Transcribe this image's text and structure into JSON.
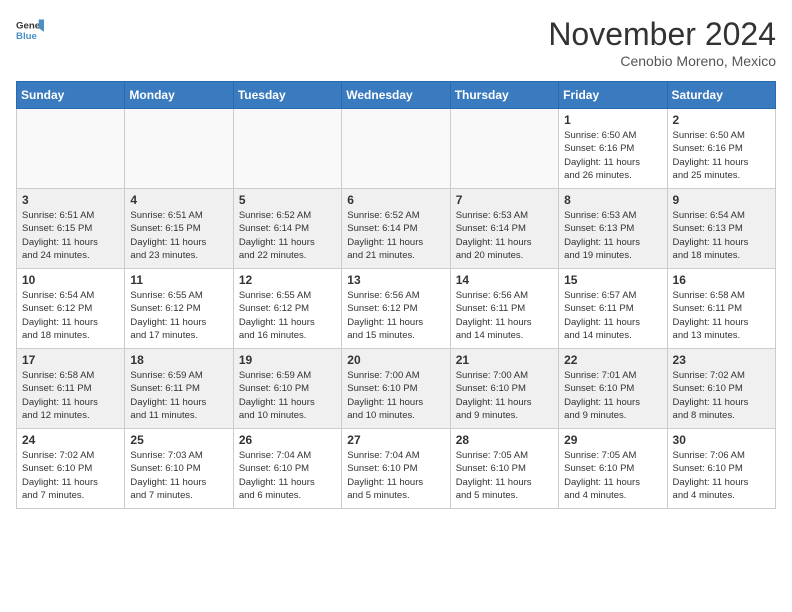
{
  "logo": {
    "text_general": "General",
    "text_blue": "Blue"
  },
  "title": "November 2024",
  "subtitle": "Cenobio Moreno, Mexico",
  "days_of_week": [
    "Sunday",
    "Monday",
    "Tuesday",
    "Wednesday",
    "Thursday",
    "Friday",
    "Saturday"
  ],
  "weeks": [
    [
      {
        "day": "",
        "info": ""
      },
      {
        "day": "",
        "info": ""
      },
      {
        "day": "",
        "info": ""
      },
      {
        "day": "",
        "info": ""
      },
      {
        "day": "",
        "info": ""
      },
      {
        "day": "1",
        "info": "Sunrise: 6:50 AM\nSunset: 6:16 PM\nDaylight: 11 hours\nand 26 minutes."
      },
      {
        "day": "2",
        "info": "Sunrise: 6:50 AM\nSunset: 6:16 PM\nDaylight: 11 hours\nand 25 minutes."
      }
    ],
    [
      {
        "day": "3",
        "info": "Sunrise: 6:51 AM\nSunset: 6:15 PM\nDaylight: 11 hours\nand 24 minutes."
      },
      {
        "day": "4",
        "info": "Sunrise: 6:51 AM\nSunset: 6:15 PM\nDaylight: 11 hours\nand 23 minutes."
      },
      {
        "day": "5",
        "info": "Sunrise: 6:52 AM\nSunset: 6:14 PM\nDaylight: 11 hours\nand 22 minutes."
      },
      {
        "day": "6",
        "info": "Sunrise: 6:52 AM\nSunset: 6:14 PM\nDaylight: 11 hours\nand 21 minutes."
      },
      {
        "day": "7",
        "info": "Sunrise: 6:53 AM\nSunset: 6:14 PM\nDaylight: 11 hours\nand 20 minutes."
      },
      {
        "day": "8",
        "info": "Sunrise: 6:53 AM\nSunset: 6:13 PM\nDaylight: 11 hours\nand 19 minutes."
      },
      {
        "day": "9",
        "info": "Sunrise: 6:54 AM\nSunset: 6:13 PM\nDaylight: 11 hours\nand 18 minutes."
      }
    ],
    [
      {
        "day": "10",
        "info": "Sunrise: 6:54 AM\nSunset: 6:12 PM\nDaylight: 11 hours\nand 18 minutes."
      },
      {
        "day": "11",
        "info": "Sunrise: 6:55 AM\nSunset: 6:12 PM\nDaylight: 11 hours\nand 17 minutes."
      },
      {
        "day": "12",
        "info": "Sunrise: 6:55 AM\nSunset: 6:12 PM\nDaylight: 11 hours\nand 16 minutes."
      },
      {
        "day": "13",
        "info": "Sunrise: 6:56 AM\nSunset: 6:12 PM\nDaylight: 11 hours\nand 15 minutes."
      },
      {
        "day": "14",
        "info": "Sunrise: 6:56 AM\nSunset: 6:11 PM\nDaylight: 11 hours\nand 14 minutes."
      },
      {
        "day": "15",
        "info": "Sunrise: 6:57 AM\nSunset: 6:11 PM\nDaylight: 11 hours\nand 14 minutes."
      },
      {
        "day": "16",
        "info": "Sunrise: 6:58 AM\nSunset: 6:11 PM\nDaylight: 11 hours\nand 13 minutes."
      }
    ],
    [
      {
        "day": "17",
        "info": "Sunrise: 6:58 AM\nSunset: 6:11 PM\nDaylight: 11 hours\nand 12 minutes."
      },
      {
        "day": "18",
        "info": "Sunrise: 6:59 AM\nSunset: 6:11 PM\nDaylight: 11 hours\nand 11 minutes."
      },
      {
        "day": "19",
        "info": "Sunrise: 6:59 AM\nSunset: 6:10 PM\nDaylight: 11 hours\nand 10 minutes."
      },
      {
        "day": "20",
        "info": "Sunrise: 7:00 AM\nSunset: 6:10 PM\nDaylight: 11 hours\nand 10 minutes."
      },
      {
        "day": "21",
        "info": "Sunrise: 7:00 AM\nSunset: 6:10 PM\nDaylight: 11 hours\nand 9 minutes."
      },
      {
        "day": "22",
        "info": "Sunrise: 7:01 AM\nSunset: 6:10 PM\nDaylight: 11 hours\nand 9 minutes."
      },
      {
        "day": "23",
        "info": "Sunrise: 7:02 AM\nSunset: 6:10 PM\nDaylight: 11 hours\nand 8 minutes."
      }
    ],
    [
      {
        "day": "24",
        "info": "Sunrise: 7:02 AM\nSunset: 6:10 PM\nDaylight: 11 hours\nand 7 minutes."
      },
      {
        "day": "25",
        "info": "Sunrise: 7:03 AM\nSunset: 6:10 PM\nDaylight: 11 hours\nand 7 minutes."
      },
      {
        "day": "26",
        "info": "Sunrise: 7:04 AM\nSunset: 6:10 PM\nDaylight: 11 hours\nand 6 minutes."
      },
      {
        "day": "27",
        "info": "Sunrise: 7:04 AM\nSunset: 6:10 PM\nDaylight: 11 hours\nand 5 minutes."
      },
      {
        "day": "28",
        "info": "Sunrise: 7:05 AM\nSunset: 6:10 PM\nDaylight: 11 hours\nand 5 minutes."
      },
      {
        "day": "29",
        "info": "Sunrise: 7:05 AM\nSunset: 6:10 PM\nDaylight: 11 hours\nand 4 minutes."
      },
      {
        "day": "30",
        "info": "Sunrise: 7:06 AM\nSunset: 6:10 PM\nDaylight: 11 hours\nand 4 minutes."
      }
    ]
  ]
}
